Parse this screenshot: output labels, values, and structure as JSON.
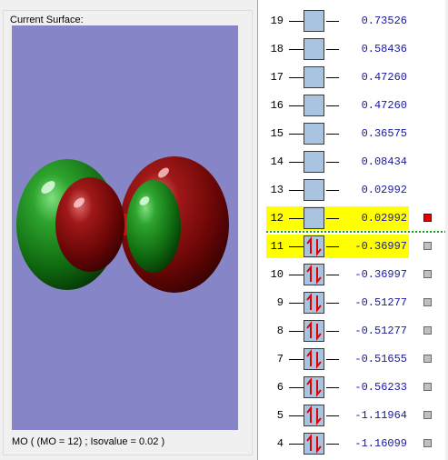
{
  "surface_group": {
    "title": "Current Surface:",
    "caption": "MO ( (MO = 12) ; Isovalue = 0.02 )"
  },
  "colors": {
    "viewport_background": "#8585c8",
    "lobe_green": "#1e8a1e",
    "lobe_red": "#8a0a0a",
    "highlight": "#ffff00",
    "energy_text": "#1818a0",
    "selected_marker": "#e00000",
    "gap_line": "#12a812"
  },
  "orbitals": [
    {
      "number": "19",
      "energy": "0.73526",
      "occupied": false,
      "highlighted": false,
      "selected": false,
      "has_marker": false
    },
    {
      "number": "18",
      "energy": "0.58436",
      "occupied": false,
      "highlighted": false,
      "selected": false,
      "has_marker": false
    },
    {
      "number": "17",
      "energy": "0.47260",
      "occupied": false,
      "highlighted": false,
      "selected": false,
      "has_marker": false
    },
    {
      "number": "16",
      "energy": "0.47260",
      "occupied": false,
      "highlighted": false,
      "selected": false,
      "has_marker": false
    },
    {
      "number": "15",
      "energy": "0.36575",
      "occupied": false,
      "highlighted": false,
      "selected": false,
      "has_marker": false
    },
    {
      "number": "14",
      "energy": "0.08434",
      "occupied": false,
      "highlighted": false,
      "selected": false,
      "has_marker": false
    },
    {
      "number": "13",
      "energy": "0.02992",
      "occupied": false,
      "highlighted": false,
      "selected": false,
      "has_marker": false
    },
    {
      "number": "12",
      "energy": "0.02992",
      "occupied": false,
      "highlighted": true,
      "selected": true,
      "has_marker": true
    },
    {
      "number": "11",
      "energy": "-0.36997",
      "occupied": true,
      "highlighted": true,
      "selected": false,
      "has_marker": true
    },
    {
      "number": "10",
      "energy": "-0.36997",
      "occupied": true,
      "highlighted": false,
      "selected": false,
      "has_marker": true
    },
    {
      "number": "9",
      "energy": "-0.51277",
      "occupied": true,
      "highlighted": false,
      "selected": false,
      "has_marker": true
    },
    {
      "number": "8",
      "energy": "-0.51277",
      "occupied": true,
      "highlighted": false,
      "selected": false,
      "has_marker": true
    },
    {
      "number": "7",
      "energy": "-0.51655",
      "occupied": true,
      "highlighted": false,
      "selected": false,
      "has_marker": true
    },
    {
      "number": "6",
      "energy": "-0.56233",
      "occupied": true,
      "highlighted": false,
      "selected": false,
      "has_marker": true
    },
    {
      "number": "5",
      "energy": "-1.11964",
      "occupied": true,
      "highlighted": false,
      "selected": false,
      "has_marker": true
    },
    {
      "number": "4",
      "energy": "-1.16099",
      "occupied": true,
      "highlighted": false,
      "selected": false,
      "has_marker": true
    }
  ]
}
